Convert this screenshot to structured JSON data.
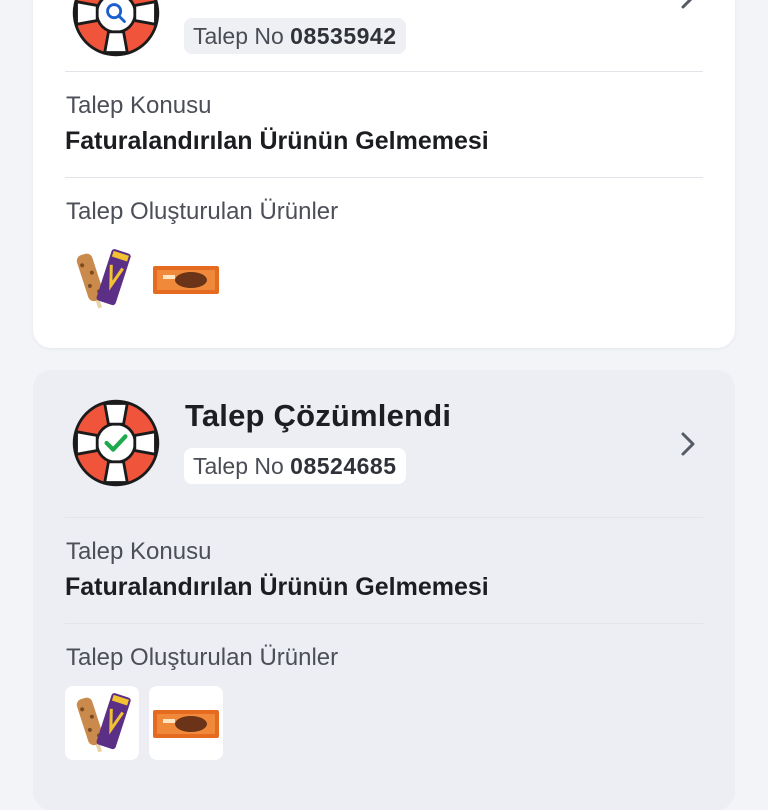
{
  "requests": [
    {
      "status_title": "",
      "ticket_prefix": "Talep No",
      "ticket_number": "08535942",
      "status_icon": "magnifier-lifebuoy-icon",
      "subject_label": "Talep Konusu",
      "subject_value": "Faturalandırılan Ürünün Gelmemesi",
      "products_label": "Talep Oluşturulan Ürünler",
      "products": [
        "ice-cream-bar-product",
        "chocolate-bar-product"
      ]
    },
    {
      "status_title": "Talep Çözümlendi",
      "ticket_prefix": "Talep No",
      "ticket_number": "08524685",
      "status_icon": "check-lifebuoy-icon",
      "subject_label": "Talep Konusu",
      "subject_value": "Faturalandırılan Ürünün Gelmemesi",
      "products_label": "Talep Oluşturulan Ürünler",
      "products": [
        "ice-cream-bar-product",
        "chocolate-bar-product"
      ]
    }
  ],
  "colors": {
    "lifebuoy_red": "#f0543a",
    "check_green": "#1fa94f",
    "background": "#f3f4f8"
  }
}
